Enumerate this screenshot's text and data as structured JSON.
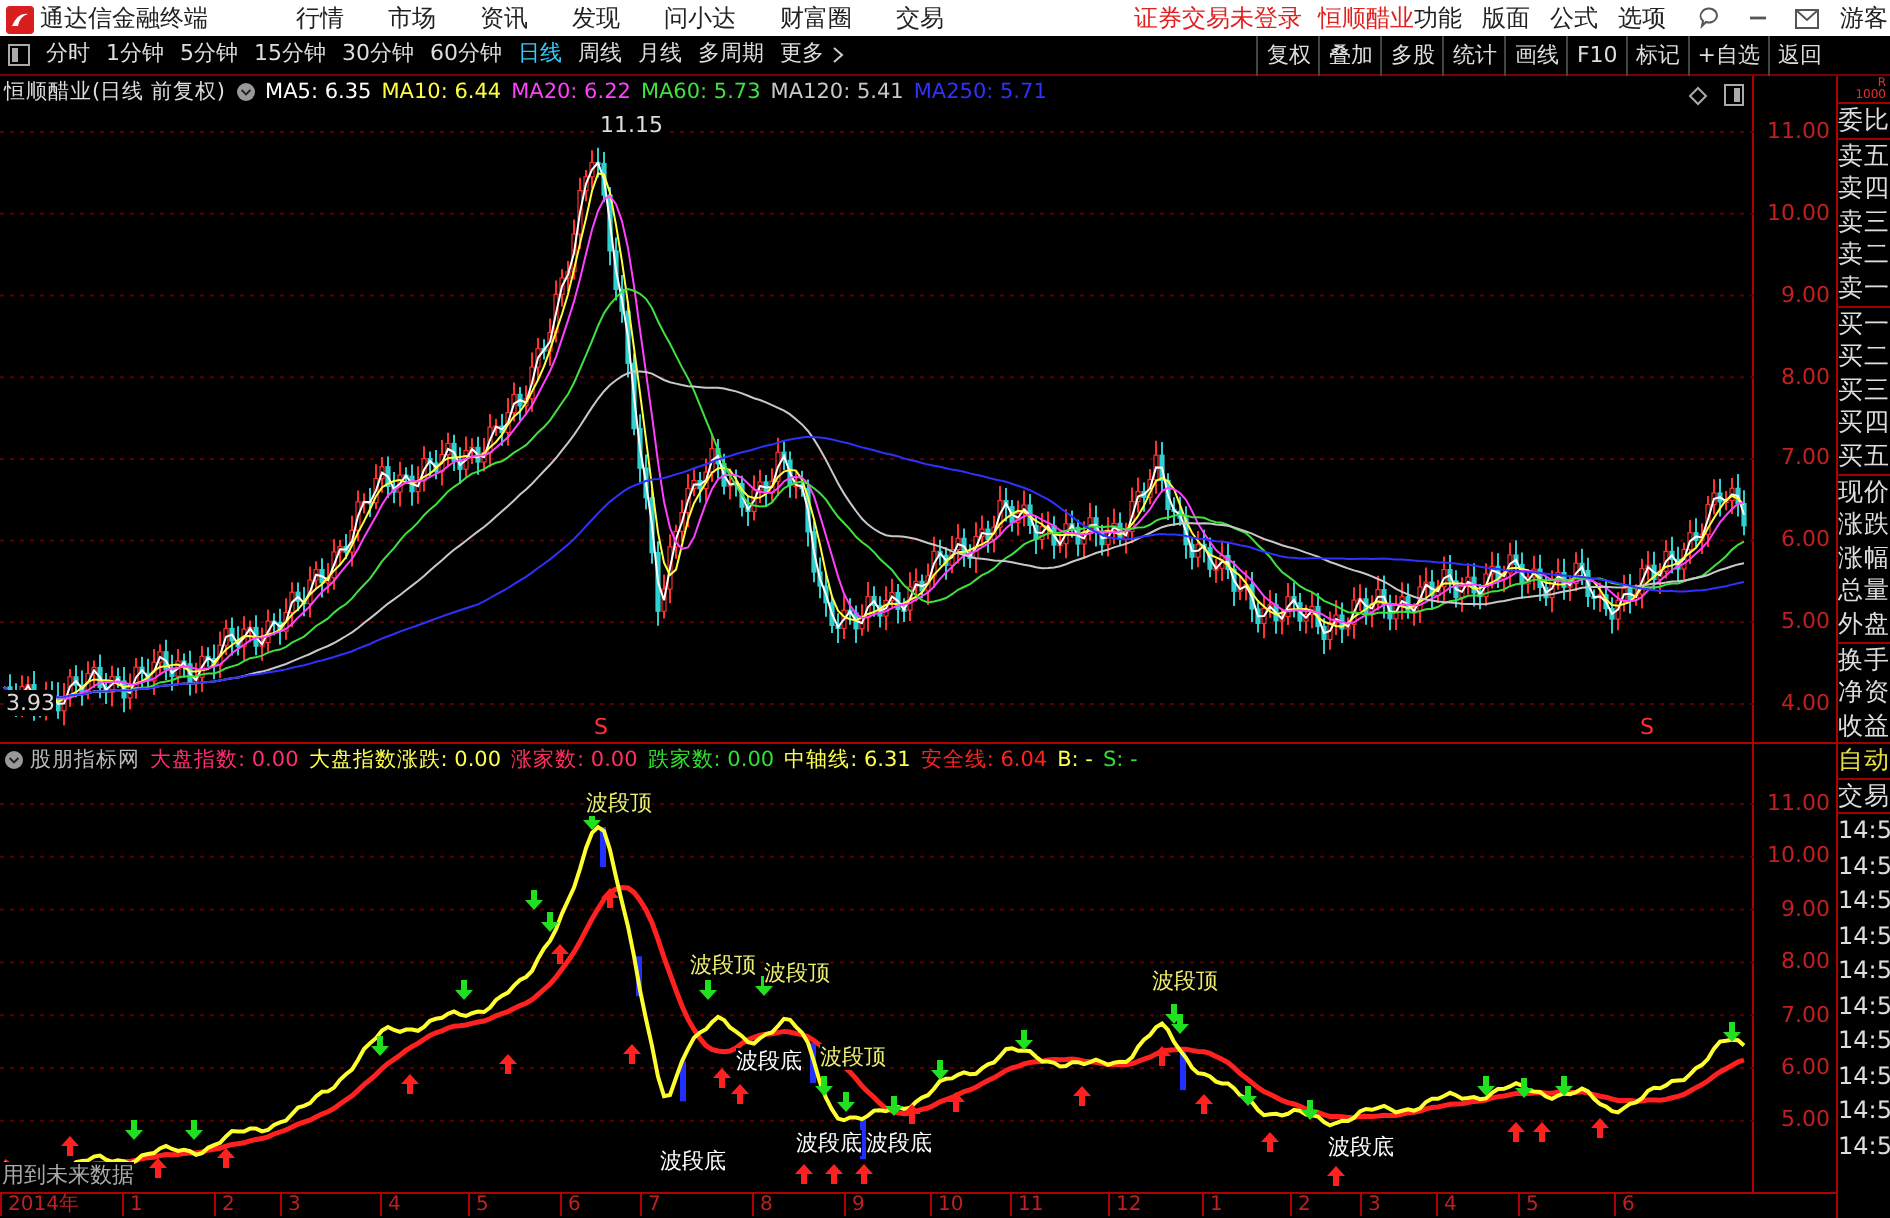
{
  "app_bar": {
    "title": "通达信金融终端",
    "menus": [
      "行情",
      "市场",
      "资讯",
      "发现",
      "问小达",
      "财富圈",
      "交易"
    ],
    "notices": [
      "证券交易未登录",
      "恒顺醋业"
    ],
    "tools": [
      "功能",
      "版面",
      "公式",
      "选项"
    ],
    "user": "游客"
  },
  "period_bar": {
    "periods": [
      {
        "label": "分时",
        "selected": false
      },
      {
        "label": "1分钟",
        "selected": false
      },
      {
        "label": "5分钟",
        "selected": false
      },
      {
        "label": "15分钟",
        "selected": false
      },
      {
        "label": "30分钟",
        "selected": false
      },
      {
        "label": "60分钟",
        "selected": false
      },
      {
        "label": "日线",
        "selected": true
      },
      {
        "label": "周线",
        "selected": false
      },
      {
        "label": "月线",
        "selected": false
      },
      {
        "label": "多周期",
        "selected": false
      },
      {
        "label": "更多",
        "selected": false
      }
    ],
    "actions": [
      "复权",
      "叠加",
      "多股",
      "统计",
      "画线",
      "F10",
      "标记",
      "+自选",
      "返回"
    ]
  },
  "price_chart": {
    "title": "恒顺醋业(日线 前复权)",
    "ma": [
      {
        "label": "MA5: 6.35",
        "color": "#ffffff"
      },
      {
        "label": "MA10: 6.44",
        "color": "#ffff40"
      },
      {
        "label": "MA20: 6.22",
        "color": "#ff40ff"
      },
      {
        "label": "MA60: 5.73",
        "color": "#40e040"
      },
      {
        "label": "MA120: 5.41",
        "color": "#c8c8c8"
      },
      {
        "label": "MA250: 5.71",
        "color": "#3030ff"
      }
    ],
    "high_label": "11.15",
    "low_label": "3.93",
    "markers": [
      "S",
      "S"
    ],
    "yticks": [
      "11.00",
      "10.00",
      "9.00",
      "8.00",
      "7.00",
      "6.00",
      "5.00",
      "4.00"
    ]
  },
  "indicator": {
    "title": "股朋指标网",
    "values": [
      {
        "label": "大盘指数: 0.00",
        "color": "#ff2d6f"
      },
      {
        "label": "大盘指数涨跌: 0.00",
        "color": "#ffff50"
      },
      {
        "label": "涨家数: 0.00",
        "color": "#ff3060"
      },
      {
        "label": "跌家数: 0.00",
        "color": "#30e030"
      },
      {
        "label": "中轴线: 6.31",
        "color": "#ffff50"
      },
      {
        "label": "安全线: 6.04",
        "color": "#ff2020"
      },
      {
        "label": "B: -",
        "color": "#ffff50"
      },
      {
        "label": "S: -",
        "color": "#30e030"
      }
    ],
    "signals": [
      {
        "text": "波段顶",
        "kind": "top"
      },
      {
        "text": "波段顶",
        "kind": "top"
      },
      {
        "text": "波段顶",
        "kind": "top"
      },
      {
        "text": "波段顶",
        "kind": "top"
      },
      {
        "text": "波段顶",
        "kind": "top"
      },
      {
        "text": "波段底",
        "kind": "bottom"
      },
      {
        "text": "波段底",
        "kind": "bottom"
      },
      {
        "text": "波段底",
        "kind": "bottom"
      },
      {
        "text": "波段底",
        "kind": "bottom"
      },
      {
        "text": "波段底",
        "kind": "bottom"
      }
    ],
    "warning": "用到未来数据",
    "yticks": [
      "11.00",
      "10.00",
      "9.00",
      "8.00",
      "7.00",
      "6.00",
      "5.00"
    ]
  },
  "time_axis": [
    "2014年",
    "1",
    "2",
    "3",
    "4",
    "5",
    "6",
    "7",
    "8",
    "9",
    "10",
    "11",
    "12",
    "1",
    "2",
    "3",
    "4",
    "5",
    "6"
  ],
  "sidebar": {
    "badge": [
      "R",
      "1000"
    ],
    "groups": [
      [
        "委比"
      ],
      [
        "卖五",
        "卖四",
        "卖三",
        "卖二",
        "卖一"
      ],
      [
        "买一",
        "买二",
        "买三",
        "买四",
        "买五"
      ],
      [
        "现价",
        "涨跌",
        "涨幅",
        "总量",
        "外盘"
      ],
      [
        "换手",
        "净资",
        "收益"
      ]
    ],
    "status": [
      {
        "label": "自动",
        "kind": "active"
      },
      {
        "label": "交易",
        "kind": "plain"
      }
    ],
    "times": [
      "14:5",
      "14:5",
      "14:5",
      "14:5",
      "14:5",
      "14:5",
      "14:5",
      "14:5",
      "14:5",
      "14:5"
    ]
  }
}
